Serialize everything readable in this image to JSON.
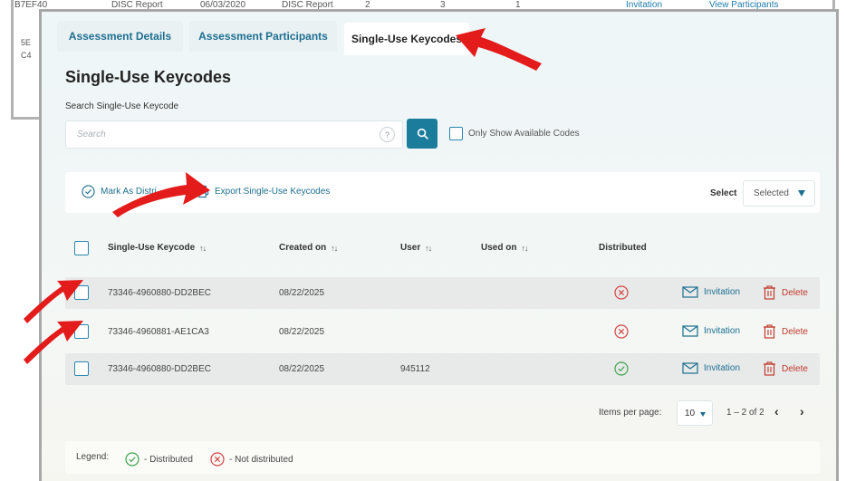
{
  "background_window": {
    "row": [
      "B7EF40",
      "DISC Report",
      "06/03/2020",
      "DISC Report",
      "2",
      "3",
      "1",
      "Invitation",
      "View Participants"
    ],
    "fragments": [
      "5E",
      "C4"
    ]
  },
  "tabs": [
    {
      "label": "Assessment Details"
    },
    {
      "label": "Assessment Participants"
    },
    {
      "label": "Single-Use Keycodes"
    }
  ],
  "page": {
    "title": "Single-Use Keycodes",
    "search_label": "Search Single-Use Keycode",
    "search_placeholder": "Search",
    "help_glyph": "?",
    "only_available_label": "Only Show Available Codes"
  },
  "toolbar": {
    "mark_label": "Mark As Distributed",
    "mark_visible": "Mark As Distri",
    "export_label": "Export Single-Use Keycodes",
    "select_label": "Select",
    "select_value": "Selected"
  },
  "table": {
    "columns": [
      "Single-Use Keycode",
      "Created on",
      "User",
      "Used on",
      "Distributed"
    ],
    "sort_glyph": "↑↓",
    "rows": [
      {
        "keycode": "73346-4960880-DD2BEC",
        "created": "08/22/2025",
        "user": "",
        "used_on": "",
        "distributed": false,
        "invitation": "Invitation",
        "delete": "Delete"
      },
      {
        "keycode": "73346-4960881-AE1CA3",
        "created": "08/22/2025",
        "user": "",
        "used_on": "",
        "distributed": false,
        "invitation": "Invitation",
        "delete": "Delete"
      },
      {
        "keycode": "73346-4960880-DD2BEC",
        "created": "08/22/2025",
        "user": "945112",
        "used_on": "",
        "distributed": true,
        "invitation": "Invitation",
        "delete": "Delete"
      }
    ]
  },
  "pagination": {
    "items_per_page_label": "Items per page:",
    "items_per_page": "10",
    "range": "1 – 2 of 2",
    "prev": "‹",
    "next": "›"
  },
  "legend": {
    "label": "Legend:",
    "distributed": "- Distributed",
    "not_distributed": "- Not distributed"
  },
  "colors": {
    "accent": "#1d6f90",
    "primary_button": "#1c7c9c",
    "distributed": "#3fa34d",
    "not_distributed": "#d64545",
    "delete": "#c0392b",
    "annotation_arrow": "#e31b1b"
  }
}
